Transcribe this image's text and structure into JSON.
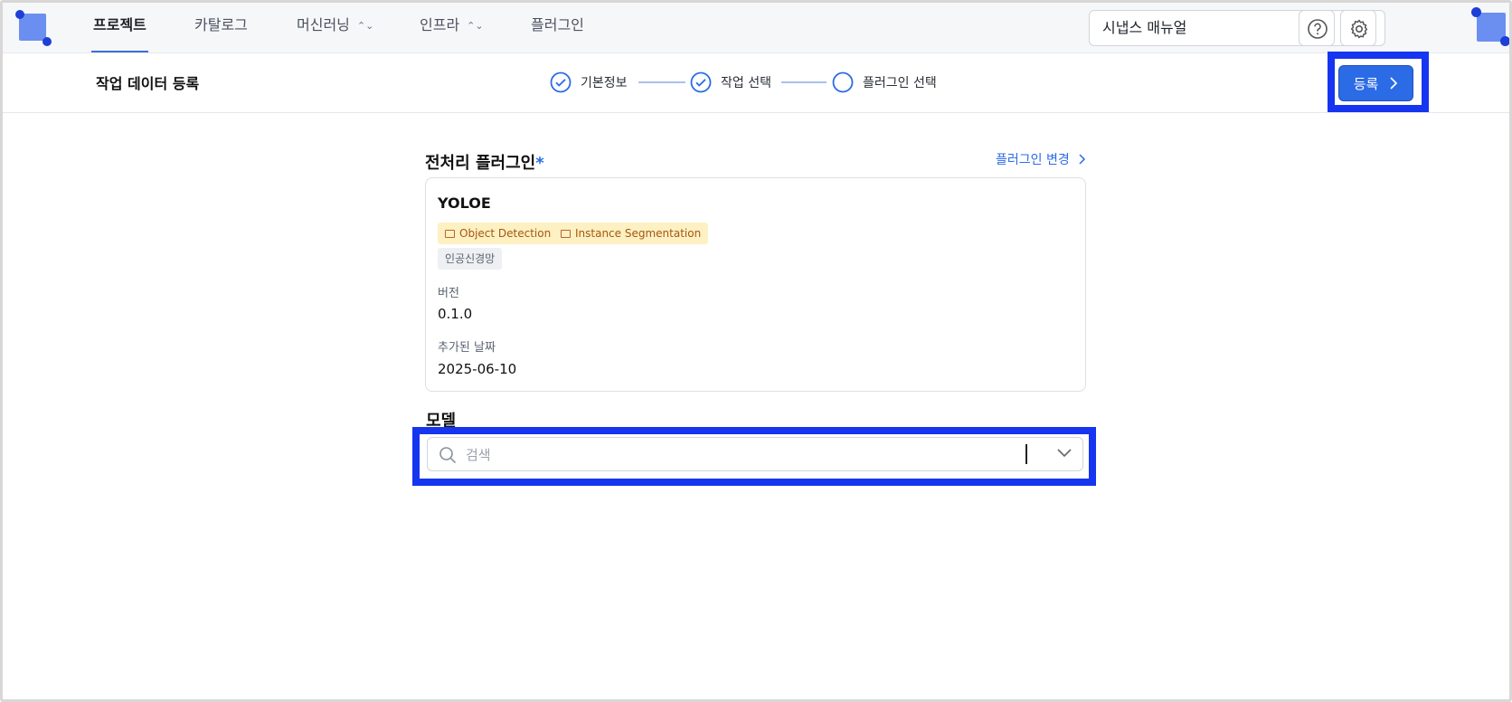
{
  "nav": {
    "items": [
      {
        "label": "프로젝트",
        "active": true
      },
      {
        "label": "카탈로그"
      },
      {
        "label": "머신러닝",
        "expandable": true
      },
      {
        "label": "인프라",
        "expandable": true
      },
      {
        "label": "플러그인"
      }
    ],
    "manual_select": "시냅스 매뉴얼",
    "help_icon": "help-circle-icon",
    "settings_icon": "gear-icon"
  },
  "subheader": {
    "title": "작업 데이터 등록",
    "steps": [
      {
        "label": "기본정보",
        "state": "done"
      },
      {
        "label": "작업 선택",
        "state": "done"
      },
      {
        "label": "플러그인 선택",
        "state": "current"
      }
    ],
    "register_label": "등록"
  },
  "plugin_section": {
    "title": "전처리 플러그인",
    "required_mark": "*",
    "change_link": "플러그인 변경",
    "plugin": {
      "name": "YOLOE",
      "tags": [
        "Object Detection",
        "Instance Segmentation"
      ],
      "category": "인공신경망",
      "version_label": "버전",
      "version": "0.1.0",
      "date_label": "추가된 날짜",
      "date": "2025-06-10"
    }
  },
  "model_section": {
    "title": "모델",
    "search_placeholder": "검색"
  },
  "colors": {
    "accent": "#2c6be6",
    "highlight": "#1535f0",
    "tag_yellow_bg": "#fdf0c2",
    "tag_yellow_text": "#a4570f"
  }
}
